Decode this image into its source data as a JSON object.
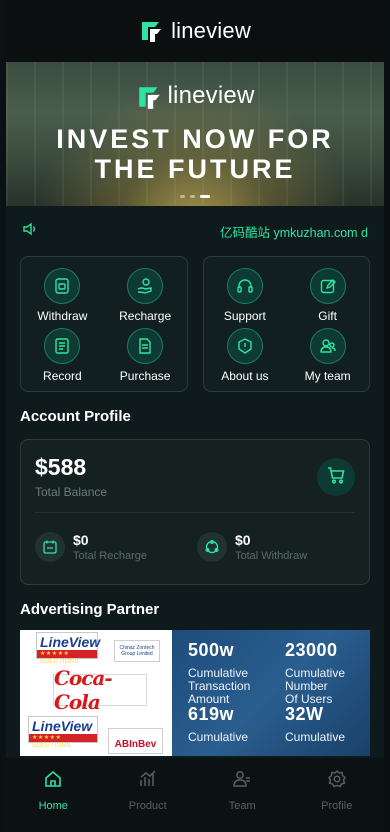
{
  "header": {
    "brand": "lineview"
  },
  "banner": {
    "brand": "lineview",
    "line1": "INVEST NOW FOR",
    "line2": "THE FUTURE",
    "slide_count": 3,
    "active_slide": 2
  },
  "notice": {
    "text": "亿码酷站 ymkuzhan.com d"
  },
  "quick_left": [
    {
      "label": "Withdraw",
      "icon": "wallet-icon"
    },
    {
      "label": "Recharge",
      "icon": "hand-coin-icon"
    },
    {
      "label": "Record",
      "icon": "ledger-icon"
    },
    {
      "label": "Purchase",
      "icon": "document-icon"
    }
  ],
  "quick_right": [
    {
      "label": "Support",
      "icon": "headset-icon"
    },
    {
      "label": "Gift",
      "icon": "edit-icon"
    },
    {
      "label": "About us",
      "icon": "alert-circle-icon"
    },
    {
      "label": "My team",
      "icon": "users-icon"
    }
  ],
  "account": {
    "title": "Account Profile",
    "balance": "$588",
    "balance_label": "Total Balance",
    "recharge_value": "$0",
    "recharge_label": "Total Recharge",
    "withdraw_value": "$0",
    "withdraw_label": "Total Withdraw"
  },
  "partner": {
    "title": "Advertising Partner",
    "stats": [
      {
        "value": "500w",
        "label": "Cumulative\nTransaction\n Amount"
      },
      {
        "value": "23000",
        "label": "Cumulative\nNumber\nOf Users"
      },
      {
        "value": "619w",
        "label": "Cumulative"
      },
      {
        "value": "32W",
        "label": "Cumulative"
      }
    ],
    "logos": {
      "lineview_top": "LineView",
      "lineview_bar": "★★★★★ SOLUTIONS",
      "chinaz": "Chinaz Zontech\nGroup Limited",
      "coke": "Coca-Cola",
      "lineview2_top": "LineView",
      "lineview2_bar": "★★★★★ SOLUTIONS",
      "abinbev": "ABInBev"
    }
  },
  "tabs": [
    {
      "label": "Home",
      "icon": "home-icon",
      "active": true
    },
    {
      "label": "Product",
      "icon": "bar-chart-icon",
      "active": false
    },
    {
      "label": "Team",
      "icon": "team-icon",
      "active": false
    },
    {
      "label": "Profile",
      "icon": "settings-icon",
      "active": false
    }
  ],
  "colors": {
    "accent": "#2fe3a0",
    "background": "#0f1a1c",
    "card": "#14211f"
  }
}
